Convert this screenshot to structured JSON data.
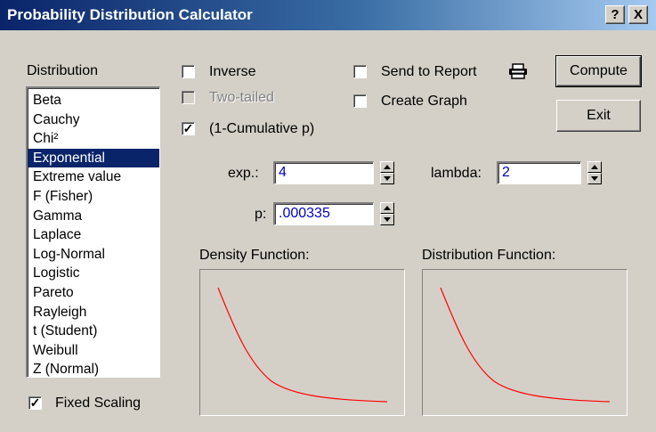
{
  "window": {
    "title": "Probability Distribution Calculator",
    "help_label": "?",
    "close_label": "X"
  },
  "distribution": {
    "label": "Distribution",
    "items": [
      "Beta",
      "Cauchy",
      "Chi²",
      "Exponential",
      "Extreme value",
      "F (Fisher)",
      "Gamma",
      "Laplace",
      "Log-Normal",
      "Logistic",
      "Pareto",
      "Rayleigh",
      "t (Student)",
      "Weibull",
      "Z (Normal)"
    ],
    "selected": "Exponential"
  },
  "options": {
    "inverse": {
      "label": "Inverse",
      "checked": false
    },
    "two_tailed": {
      "label": "Two-tailed",
      "checked": false,
      "enabled": false
    },
    "one_minus_cumulative": {
      "label": "(1-Cumulative p)",
      "checked": true,
      "mark": "✓"
    },
    "send_to_report": {
      "label": "Send to Report",
      "checked": false
    },
    "create_graph": {
      "label": "Create Graph",
      "checked": false
    },
    "fixed_scaling": {
      "label": "Fixed Scaling",
      "checked": true,
      "mark": "✓"
    }
  },
  "buttons": {
    "compute": "Compute",
    "exit": "Exit"
  },
  "params": {
    "exp_label": "exp.:",
    "exp_value": "4",
    "lambda_label": "lambda:",
    "lambda_value": "2",
    "p_label": "p:",
    "p_value": ".000335"
  },
  "plots": {
    "density_label": "Density Function:",
    "distribution_label": "Distribution Function:",
    "curve_color": "#ff0000",
    "curve_shape": "exponential decay"
  },
  "icons": {
    "printer": "printer-icon"
  }
}
